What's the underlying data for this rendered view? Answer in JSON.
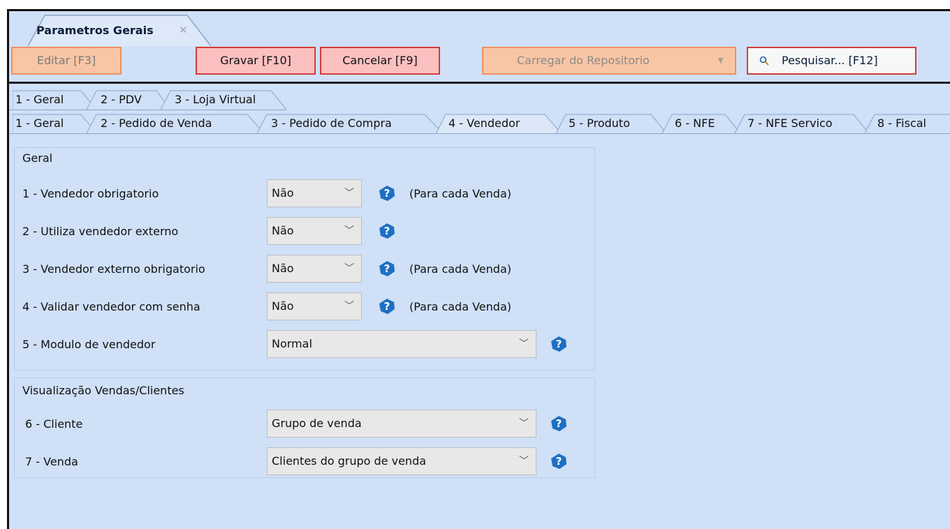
{
  "document_tab": {
    "title": "Parametros Gerais",
    "close_glyph": "✕"
  },
  "toolbar": {
    "editar": "Editar [F3]",
    "gravar": "Gravar [F10]",
    "cancelar": "Cancelar [F9]",
    "carregar": "Carregar do Repositorio",
    "pesquisar": "Pesquisar... [F12]"
  },
  "tabs_row1": [
    "1 - Geral",
    "2 - PDV",
    "3 - Loja Virtual"
  ],
  "tabs_row2": [
    "1 - Geral",
    "2 - Pedido de Venda",
    "3 - Pedido de Compra",
    "4 - Vendedor",
    "5 - Produto",
    "6 - NFE",
    "7 - NFE Servico",
    "8 - Fiscal"
  ],
  "active_tab_row2": "4 - Vendedor",
  "geral": {
    "title": "Geral",
    "rows": [
      {
        "label": "1 - Vendedor obrigatorio",
        "value": "Não",
        "note": "(Para cada Venda)"
      },
      {
        "label": "2 - Utiliza vendedor externo",
        "value": "Não",
        "note": ""
      },
      {
        "label": "3 - Vendedor externo obrigatorio",
        "value": "Não",
        "note": "(Para cada Venda)"
      },
      {
        "label": "4 - Validar vendedor com senha",
        "value": "Não",
        "note": "(Para cada Venda)"
      },
      {
        "label": "5 - Modulo de vendedor",
        "value": "Normal",
        "note": ""
      }
    ]
  },
  "visualizacao": {
    "title": "Visualização Vendas/Clientes",
    "rows": [
      {
        "label": "6 - Cliente",
        "value": "Grupo de venda"
      },
      {
        "label": "7 - Venda",
        "value": "Clientes do grupo de venda"
      }
    ]
  },
  "icons": {
    "help": "help-icon",
    "search": "search-icon",
    "chevron": "chevron-down-icon"
  },
  "colors": {
    "background": "#cfe0f7",
    "help_blue": "#1f6fc4",
    "button_red_border": "#d23b3b",
    "button_disabled": "#f9c6a5"
  }
}
